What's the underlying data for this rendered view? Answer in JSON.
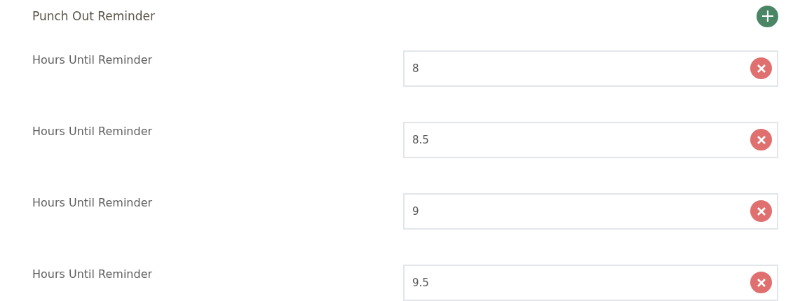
{
  "section": {
    "title": "Punch Out Reminder"
  },
  "reminders": [
    {
      "label": "Hours Until Reminder",
      "value": "8"
    },
    {
      "label": "Hours Until Reminder",
      "value": "8.5"
    },
    {
      "label": "Hours Until Reminder",
      "value": "9"
    },
    {
      "label": "Hours Until Reminder",
      "value": "9.5"
    }
  ]
}
